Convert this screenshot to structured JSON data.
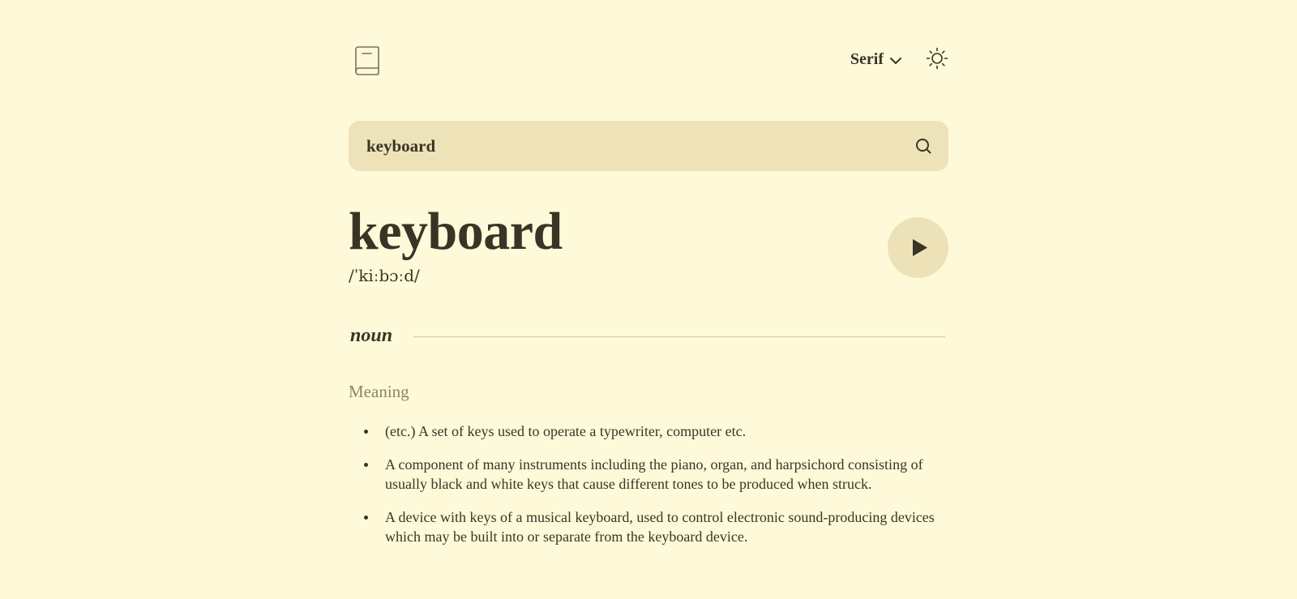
{
  "header": {
    "logo_icon": "book-icon",
    "font_selector": {
      "selected": "Serif",
      "icon": "chevron-down-icon"
    },
    "theme_toggle_icon": "sun-icon"
  },
  "search": {
    "value": "keyboard",
    "icon": "search-icon"
  },
  "entry": {
    "word": "keyboard",
    "phonetic": "/ˈkiːbɔːd/",
    "play_icon": "play-icon",
    "part_of_speech": "noun",
    "meaning_heading": "Meaning",
    "definitions": [
      "(etc.) A set of keys used to operate a typewriter, computer etc.",
      "A component of many instruments including the piano, organ, and harpsichord consisting of usually black and white keys that cause different tones to be produced when struck.",
      "A device with keys of a musical keyboard, used to control electronic sound-producing devices which may be built into or separate from the keyboard device."
    ]
  },
  "colors": {
    "background": "#FEF9D8",
    "search_background": "#EEE3B8",
    "play_button_background": "#EDE2B7",
    "text": "#3A3427",
    "muted_text": "#8C8665",
    "divider": "#CFC7A6"
  }
}
